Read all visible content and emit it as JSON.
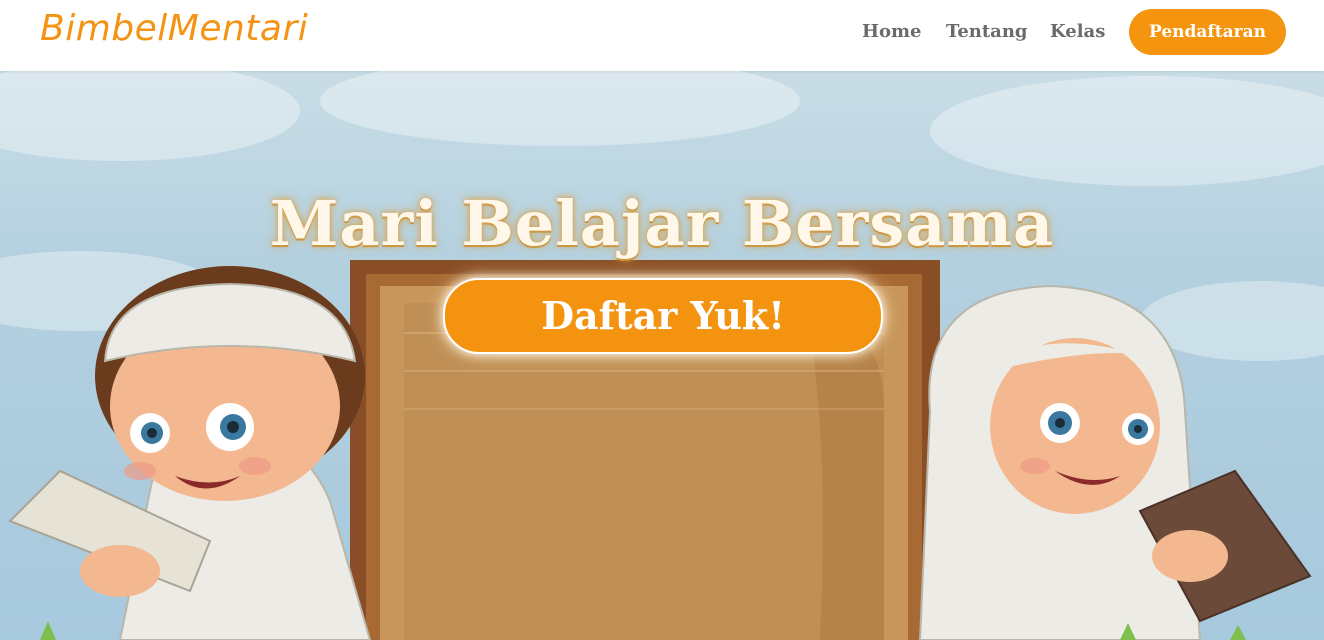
{
  "navbar": {
    "brand": "BimbelMentari",
    "links": [
      "Home",
      "Tentang",
      "Kelas"
    ],
    "cta": "Pendaftaran"
  },
  "hero": {
    "title": "Mari Belajar Bersama",
    "cta": "Daftar Yuk!"
  },
  "colors": {
    "accent": "#f5950f",
    "nav_text": "#6b6b6b",
    "sky": "#b3d0df"
  },
  "icons": [
    "boy-reading-illustration",
    "girl-reading-illustration",
    "wooden-board-illustration"
  ]
}
